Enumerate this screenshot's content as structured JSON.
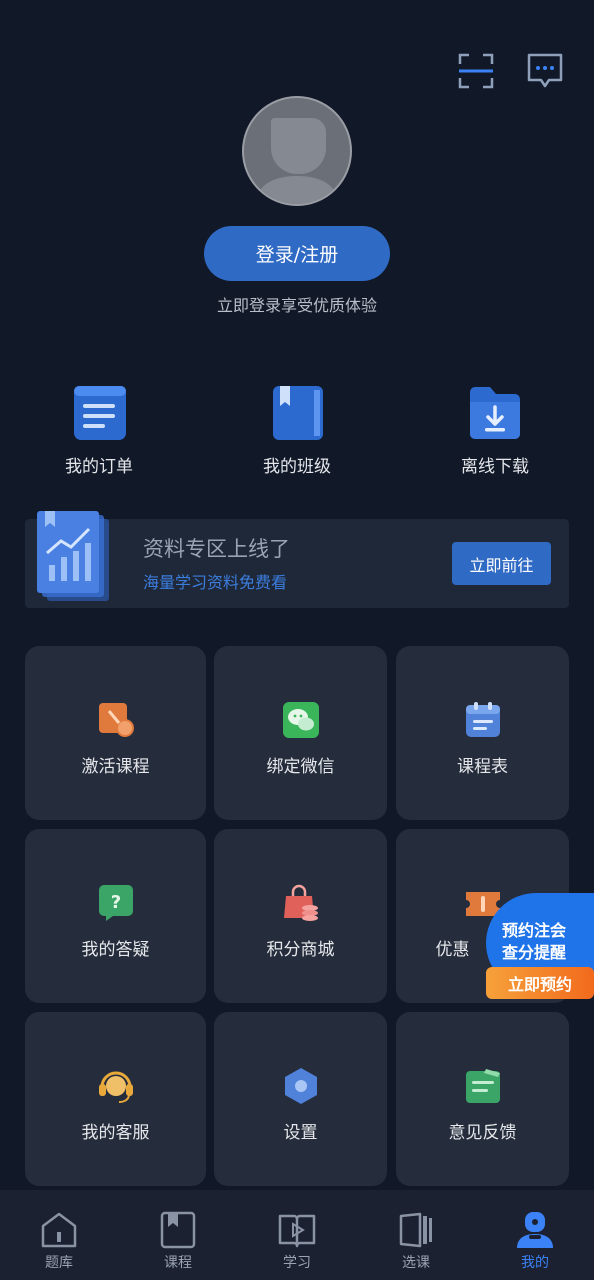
{
  "header": {
    "scan_icon": "scan-icon",
    "message_icon": "message-icon"
  },
  "profile": {
    "login_button": "登录/注册",
    "login_subtitle": "立即登录享受优质体验"
  },
  "quick_actions": [
    {
      "label": "我的订单",
      "icon": "order-icon"
    },
    {
      "label": "我的班级",
      "icon": "class-book-icon"
    },
    {
      "label": "离线下载",
      "icon": "download-folder-icon"
    }
  ],
  "banner": {
    "title": "资料专区上线了",
    "subtitle": "海量学习资料免费看",
    "button": "立即前往"
  },
  "grid": [
    {
      "label": "激活课程",
      "icon": "activate-key-icon",
      "color": "#e07a3c"
    },
    {
      "label": "绑定微信",
      "icon": "wechat-icon",
      "color": "#3bb55a"
    },
    {
      "label": "课程表",
      "icon": "schedule-icon",
      "color": "#4f82d8"
    },
    {
      "label": "我的答疑",
      "icon": "question-icon",
      "color": "#3aa567"
    },
    {
      "label": "积分商城",
      "icon": "shopping-bag-icon",
      "color": "#e0605a"
    },
    {
      "label": "优惠",
      "icon": "coupon-icon",
      "color": "#e07a3c"
    },
    {
      "label": "我的客服",
      "icon": "headset-icon",
      "color": "#e8a93a"
    },
    {
      "label": "设置",
      "icon": "settings-hex-icon",
      "color": "#4f82d8"
    },
    {
      "label": "意见反馈",
      "icon": "feedback-icon",
      "color": "#3aa567"
    }
  ],
  "promo": {
    "line1": "预约注会",
    "line2": "查分提醒",
    "button": "立即预约"
  },
  "tabbar": [
    {
      "label": "题库",
      "icon": "question-bank-icon",
      "active": false
    },
    {
      "label": "课程",
      "icon": "course-book-icon",
      "active": false
    },
    {
      "label": "学习",
      "icon": "study-play-icon",
      "active": false
    },
    {
      "label": "选课",
      "icon": "select-course-icon",
      "active": false
    },
    {
      "label": "我的",
      "icon": "profile-icon",
      "active": true
    }
  ],
  "colors": {
    "accent": "#2f6ac4",
    "background": "#111827",
    "card": "#252c3b",
    "active_tab": "#3b82f6"
  }
}
